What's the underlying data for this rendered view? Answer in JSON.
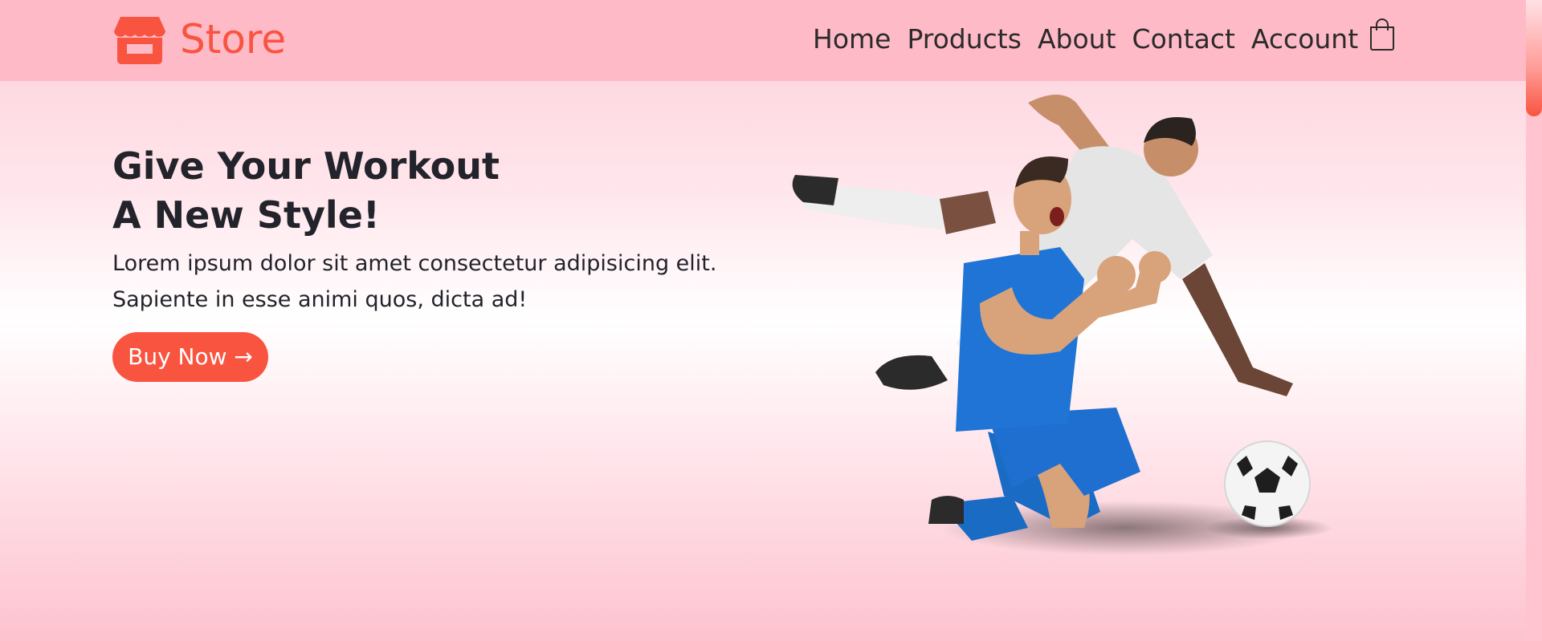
{
  "brand": {
    "name": "Store",
    "icon": "storefront-icon",
    "color": "#f85440"
  },
  "nav": {
    "items": [
      {
        "label": "Home"
      },
      {
        "label": "Products"
      },
      {
        "label": "About"
      },
      {
        "label": "Contact"
      },
      {
        "label": "Account"
      }
    ],
    "cart_icon": "shopping-bag-icon"
  },
  "hero": {
    "title_line1": "Give Your Workout",
    "title_line2": "A New Style!",
    "text_line1": "Lorem ipsum dolor sit amet consectetur adipisicing elit.",
    "text_line2": "Sapiente in esse animi quos, dicta ad!",
    "cta_label": "Buy Now →",
    "image": "soccer-players-illustration"
  },
  "colors": {
    "accent": "#f85440",
    "header_bg": "#ffbac7",
    "text": "#23232b"
  }
}
